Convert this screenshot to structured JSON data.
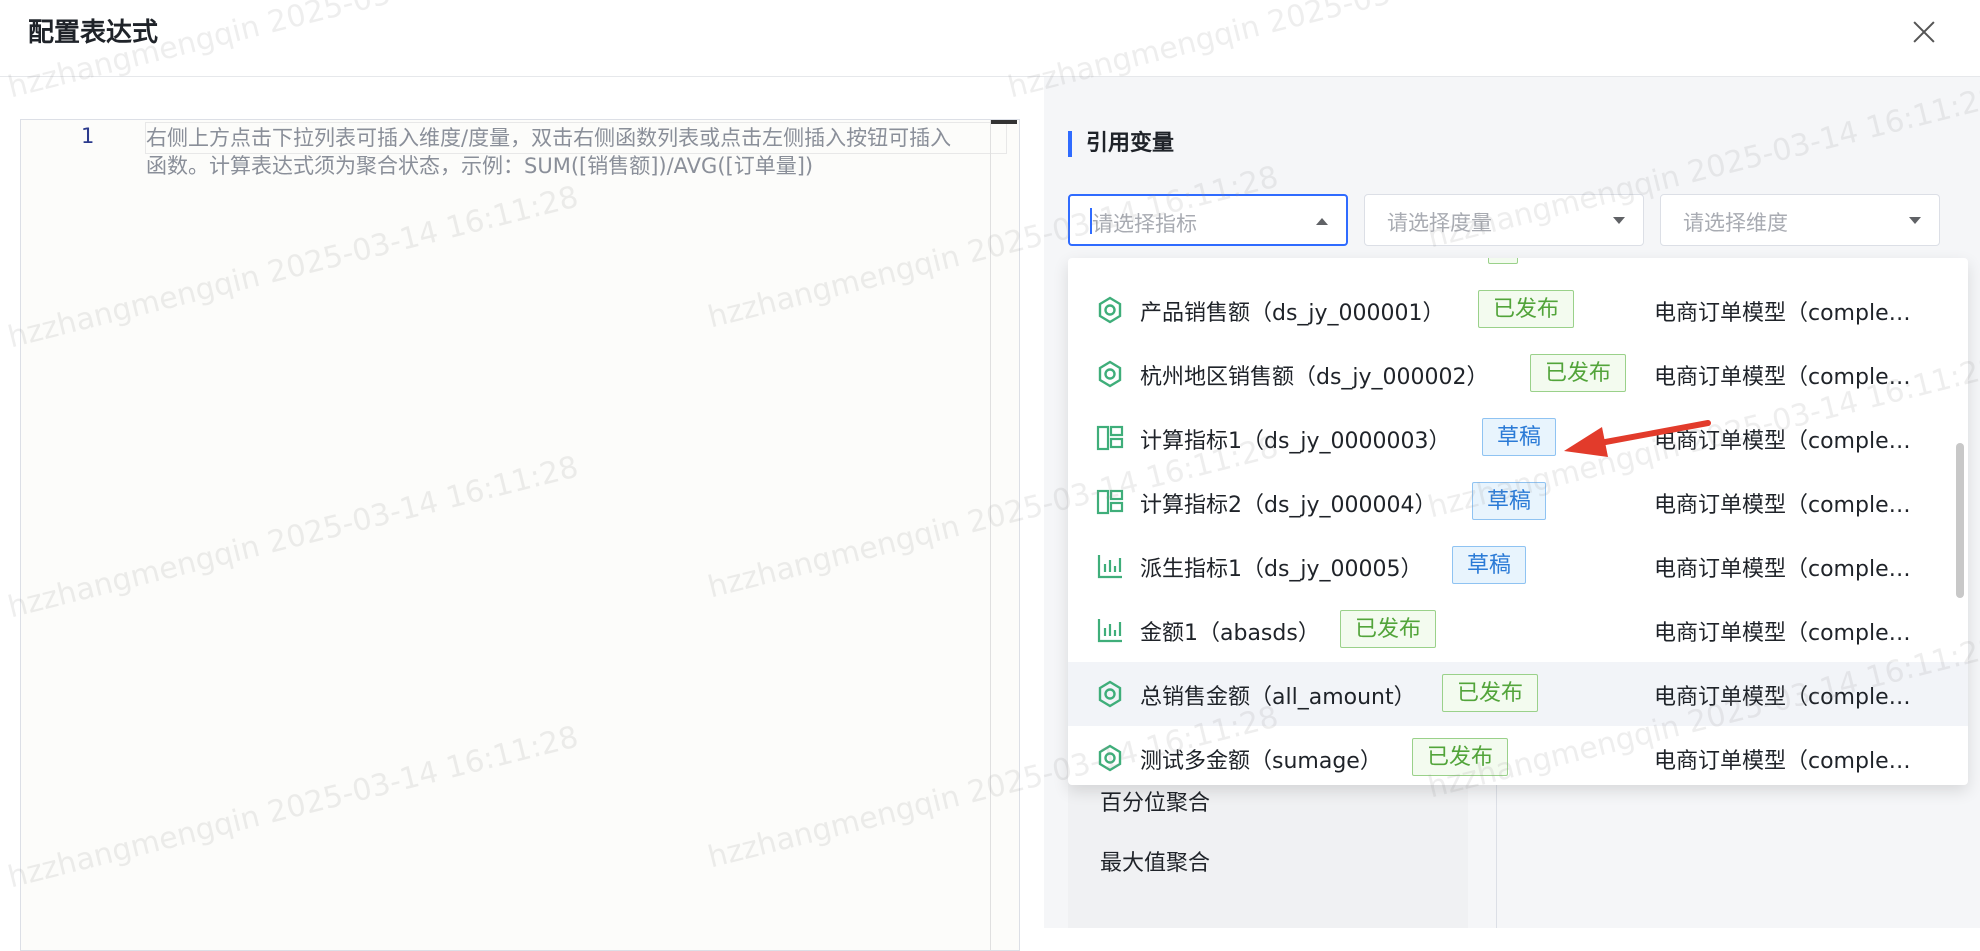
{
  "dialog": {
    "title": "配置表达式"
  },
  "editor": {
    "line_number": "1",
    "placeholder": "右侧上方点击下拉列表可插入维度/度量，双击右侧函数列表或点击左侧插入按钮可插入函数。计算表达式须为聚合状态，示例：SUM([销售额])/AVG([订单量])"
  },
  "panel": {
    "section_title": "引用变量",
    "select_metric_placeholder": "请选择指标",
    "select_measure_placeholder": "请选择度量",
    "select_dimension_placeholder": "请选择维度"
  },
  "functions": [
    "百分位聚合",
    "最大值聚合"
  ],
  "dropdown": {
    "options": [
      {
        "name": "产品销售额（ds_jy_000001）",
        "tag": "已发布",
        "tag_type": "published",
        "model": "电商订单模型（comple…",
        "icon": "gear-hex-icon"
      },
      {
        "name": "杭州地区销售额（ds_jy_000002）",
        "tag": "已发布",
        "tag_type": "published",
        "model": "电商订单模型（comple…",
        "icon": "gear-hex-icon"
      },
      {
        "name": "计算指标1（ds_jy_0000003）",
        "tag": "草稿",
        "tag_type": "draft",
        "model": "电商订单模型（comple…",
        "icon": "calc-metric-icon"
      },
      {
        "name": "计算指标2（ds_jy_000004）",
        "tag": "草稿",
        "tag_type": "draft",
        "model": "电商订单模型（comple…",
        "icon": "calc-metric-icon"
      },
      {
        "name": "派生指标1（ds_jy_00005）",
        "tag": "草稿",
        "tag_type": "draft",
        "model": "电商订单模型（comple…",
        "icon": "bar-chart-icon"
      },
      {
        "name": "金额1（abasds）",
        "tag": "已发布",
        "tag_type": "published",
        "model": "电商订单模型（comple…",
        "icon": "bar-chart-icon"
      },
      {
        "name": "总销售金额（all_amount）",
        "tag": "已发布",
        "tag_type": "published",
        "model": "电商订单模型（comple…",
        "icon": "gear-hex-icon"
      },
      {
        "name": "测试多金额（sumage）",
        "tag": "已发布",
        "tag_type": "published",
        "model": "电商订单模型（comple…",
        "icon": "gear-hex-icon"
      }
    ]
  },
  "watermark": {
    "user": "hzzhangmengqin",
    "time": "2025-03-14 16:11:28"
  },
  "colors": {
    "accent": "#2f6bff",
    "published": "#52a43a",
    "draft": "#2a7ad6",
    "icon": "#3fae7a",
    "annotation_arrow": "#e23b2b"
  }
}
